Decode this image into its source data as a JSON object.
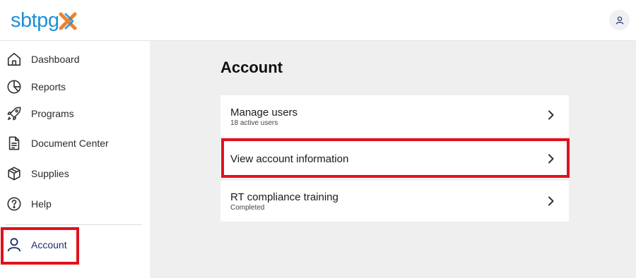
{
  "brand": {
    "name": "sbtpg",
    "colors": {
      "primary": "#1e90d6",
      "accent": "#f0822e",
      "highlight": "#e0121b",
      "nav_active": "#1f2c6b"
    }
  },
  "header": {
    "avatar_icon": "user-icon"
  },
  "sidebar": {
    "items": [
      {
        "label": "Dashboard",
        "icon": "home-icon"
      },
      {
        "label": "Reports",
        "icon": "pie-chart-icon"
      },
      {
        "label": "Programs",
        "icon": "rocket-icon"
      },
      {
        "label": "Document Center",
        "icon": "document-icon"
      },
      {
        "label": "Supplies",
        "icon": "box-icon"
      },
      {
        "label": "Help",
        "icon": "help-circle-icon"
      },
      {
        "label": "Account",
        "icon": "user-icon",
        "active": true
      }
    ]
  },
  "main": {
    "title": "Account",
    "cards": [
      {
        "title": "Manage users",
        "subtitle": "18 active users"
      },
      {
        "title": "View account information",
        "subtitle": ""
      },
      {
        "title": "RT compliance training",
        "subtitle": "Completed"
      }
    ]
  }
}
